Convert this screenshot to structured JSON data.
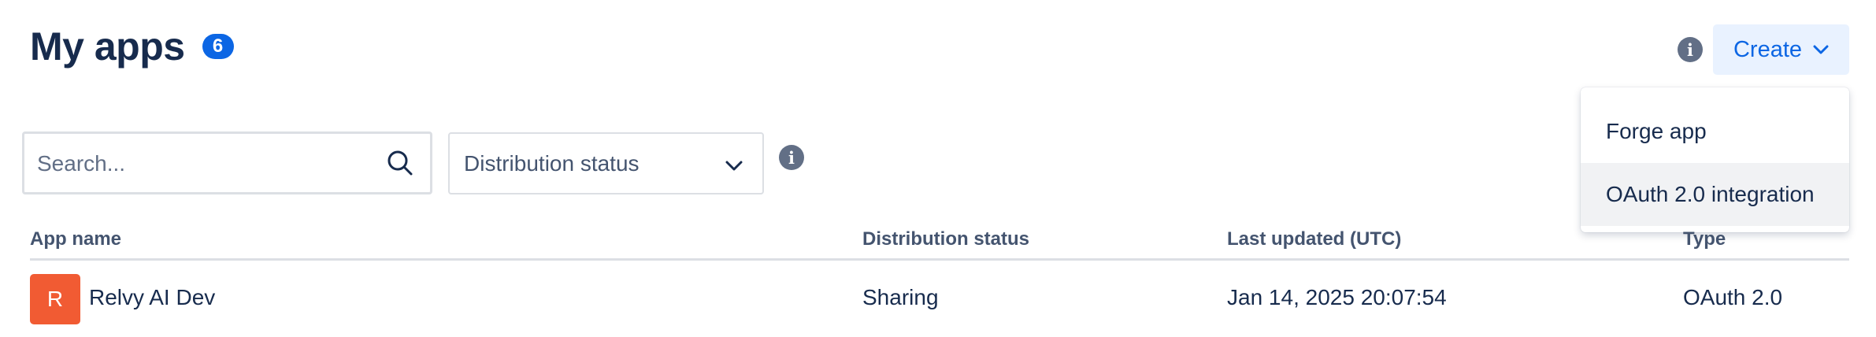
{
  "header": {
    "title": "My apps",
    "app_count": "6",
    "info_icon": "info-icon",
    "create_label": "Create"
  },
  "create_menu": {
    "items": [
      {
        "label": "Forge app"
      },
      {
        "label": "OAuth 2.0 integration",
        "state": "hovered"
      }
    ]
  },
  "filters": {
    "search_placeholder": "Search...",
    "search_value": "",
    "distribution_status_label": "Distribution status"
  },
  "table": {
    "columns": [
      "App name",
      "Distribution status",
      "Last updated (UTC)",
      "Type"
    ],
    "rows": [
      {
        "avatar_letter": "R",
        "avatar_color": "#f15b33",
        "app_name": "Relvy AI Dev",
        "distribution_status": "Sharing",
        "last_updated": "Jan 14, 2025 20:07:54",
        "type": "OAuth 2.0"
      }
    ]
  },
  "colors": {
    "accent": "#0c66e4",
    "create_bg": "#e9f2ff",
    "text": "#172b4d",
    "subtle_text": "#44546f",
    "border": "#dcdfe4"
  }
}
